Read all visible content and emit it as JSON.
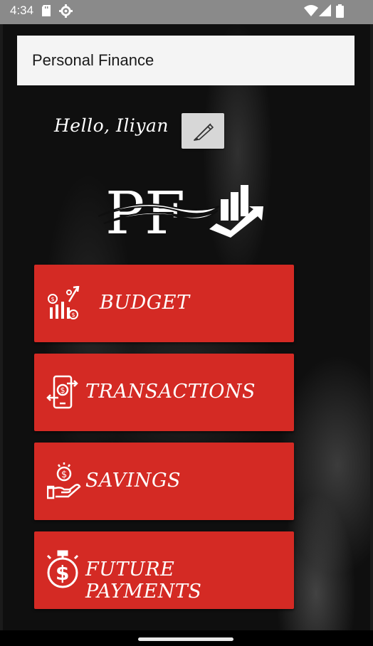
{
  "status_bar": {
    "time": "4:34",
    "icons": [
      "sd-card-icon",
      "settings-icon",
      "wifi-icon",
      "signal-icon",
      "battery-icon"
    ]
  },
  "app_bar": {
    "title": "Personal Finance"
  },
  "greeting": {
    "text": "Hello, Iliyan",
    "edit_icon": "pencil-icon"
  },
  "logo": {
    "text": "PF",
    "icon": "chart-arrow-icon"
  },
  "menu": [
    {
      "label": "BUDGET",
      "icon": "budget-chart-icon"
    },
    {
      "label": "TRANSACTIONS",
      "icon": "phone-transfer-icon"
    },
    {
      "label": "SAVINGS",
      "icon": "hand-coin-icon"
    },
    {
      "label": "FUTURE PAYMENTS",
      "icon": "stopwatch-dollar-icon"
    }
  ],
  "colors": {
    "button_red": "#d42a24",
    "app_bar_bg": "#f4f4f4",
    "status_bar_bg": "#8a8a8a",
    "background": "#0f0f0f"
  }
}
